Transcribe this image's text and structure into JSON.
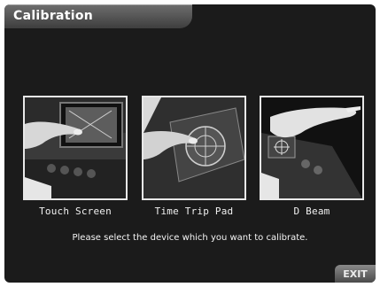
{
  "header": {
    "title": "Calibration"
  },
  "devices": [
    {
      "label": "Touch Screen",
      "icon": "touch-screen-photo"
    },
    {
      "label": "Time Trip Pad",
      "icon": "time-trip-pad-photo"
    },
    {
      "label": "D Beam",
      "icon": "d-beam-photo"
    }
  ],
  "instruction": "Please select the device which you want to calibrate.",
  "footer": {
    "exit_label": "EXIT"
  },
  "colors": {
    "background": "#1b1b1b",
    "frame": "#e8e8e8",
    "title_tab": "#5a5a5a"
  }
}
